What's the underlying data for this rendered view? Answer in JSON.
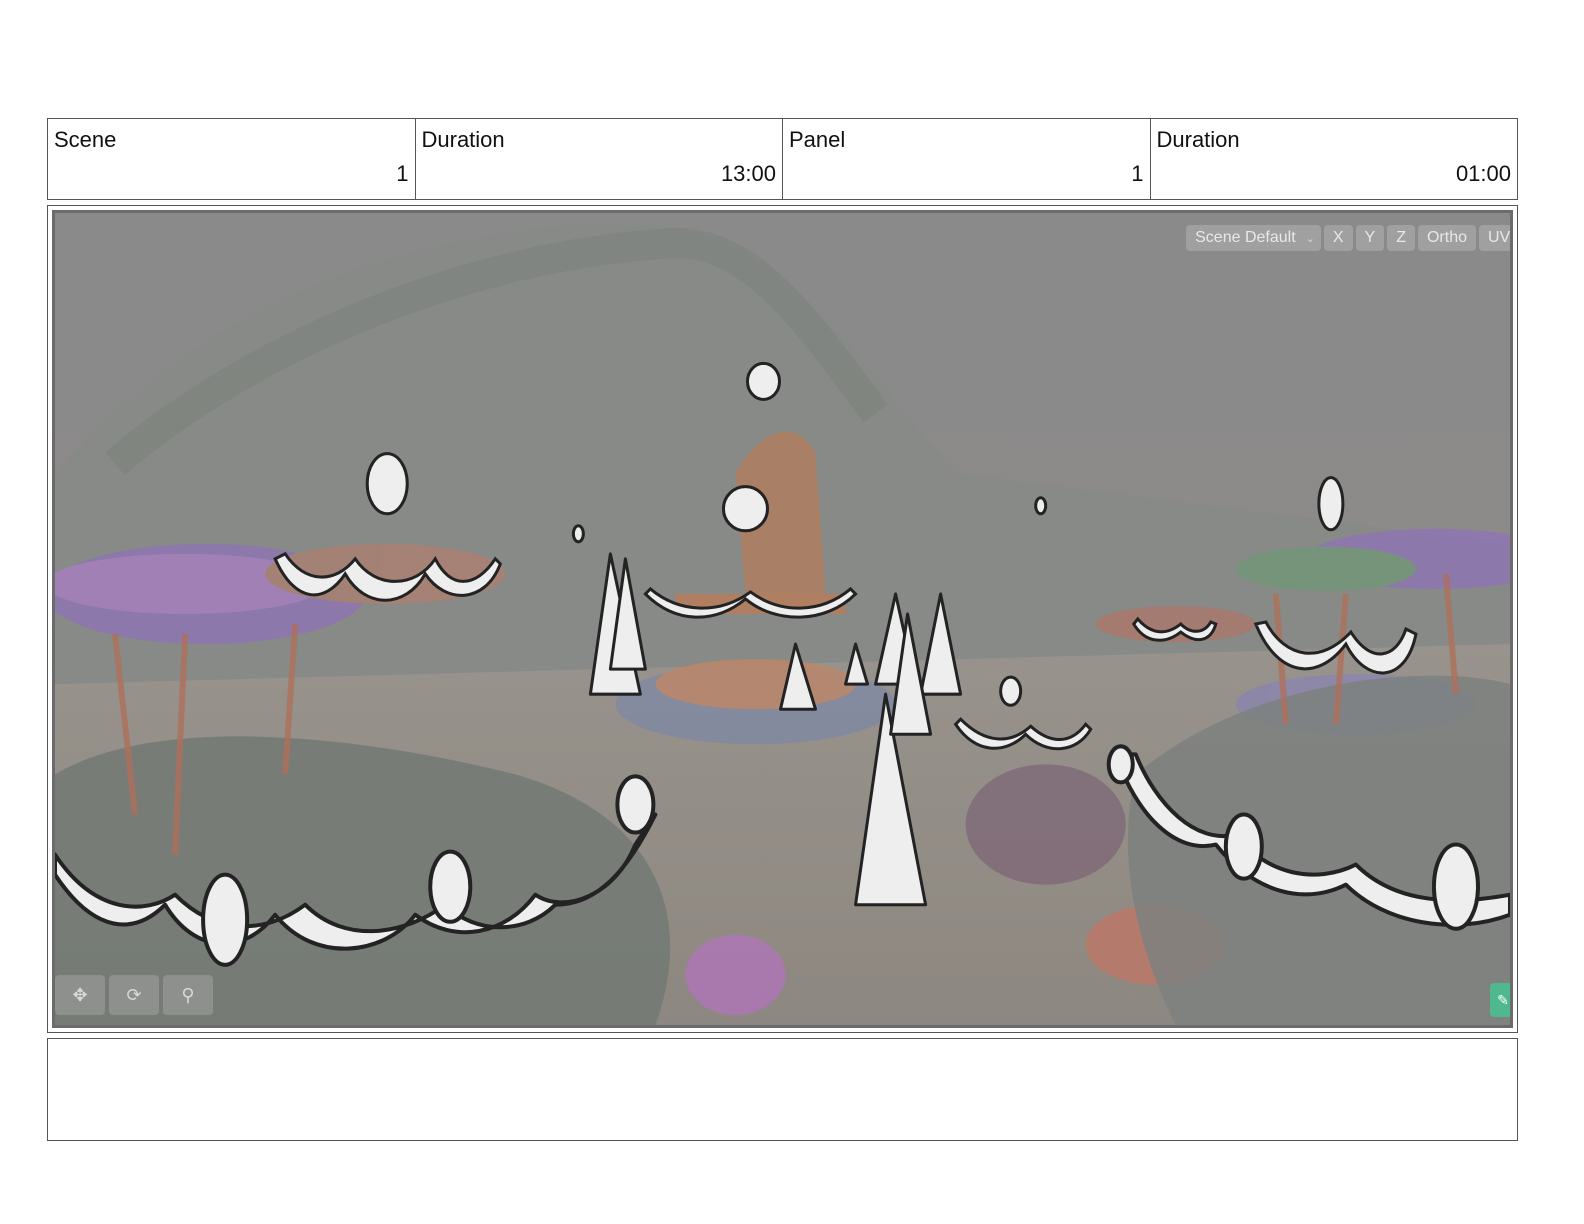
{
  "header": {
    "scene_label": "Scene",
    "scene_value": "1",
    "scene_duration_label": "Duration",
    "scene_duration_value": "13:00",
    "panel_label": "Panel",
    "panel_value": "1",
    "panel_duration_label": "Duration",
    "panel_duration_value": "01:00"
  },
  "viewport": {
    "toolbar": {
      "camera_select": "Scene Default",
      "axis_x": "X",
      "axis_y": "Y",
      "axis_z": "Z",
      "ortho": "Ortho",
      "uv": "UV"
    },
    "tools": [
      "move-icon",
      "orbit-icon",
      "zoom-icon"
    ],
    "comment_icon": "comment-icon"
  },
  "notes": {
    "text": ""
  },
  "colors": {
    "viewport_bg": "#8b8b8b",
    "accent_green": "#4fb88c"
  }
}
